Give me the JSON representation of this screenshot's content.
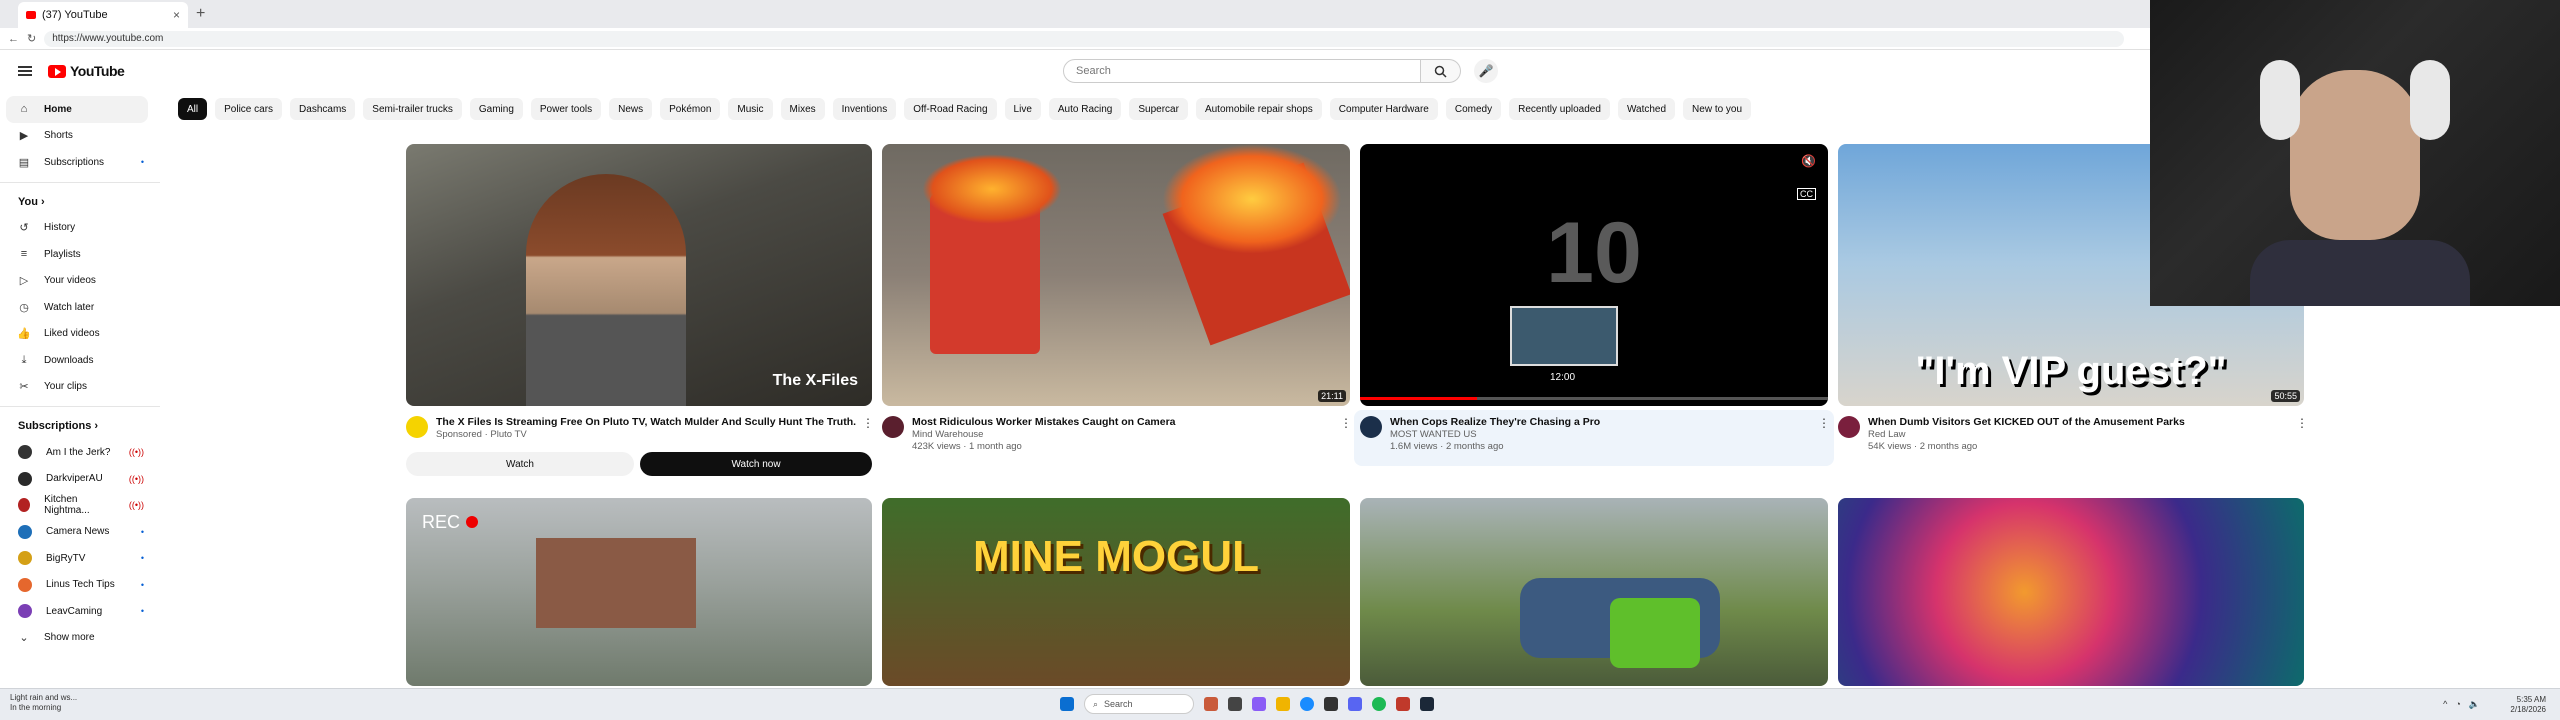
{
  "browser": {
    "tab_title": "(37) YouTube",
    "url": "https://www.youtube.com"
  },
  "header": {
    "logo_text": "YouTube",
    "search_placeholder": "Search"
  },
  "chips": [
    "All",
    "Police cars",
    "Dashcams",
    "Semi-trailer trucks",
    "Gaming",
    "Power tools",
    "News",
    "Pokémon",
    "Music",
    "Mixes",
    "Inventions",
    "Off-Road Racing",
    "Live",
    "Auto Racing",
    "Supercar",
    "Automobile repair shops",
    "Computer Hardware",
    "Comedy",
    "Recently uploaded",
    "Watched",
    "New to you"
  ],
  "sidebar": {
    "main": [
      {
        "label": "Home",
        "icon": "home-icon"
      },
      {
        "label": "Shorts",
        "icon": "shorts-icon"
      },
      {
        "label": "Subscriptions",
        "icon": "subscriptions-icon"
      }
    ],
    "you_heading": "You",
    "you": [
      {
        "label": "History",
        "icon": "history-icon"
      },
      {
        "label": "Playlists",
        "icon": "playlists-icon"
      },
      {
        "label": "Your videos",
        "icon": "your-videos-icon"
      },
      {
        "label": "Watch later",
        "icon": "watch-later-icon"
      },
      {
        "label": "Liked videos",
        "icon": "liked-icon"
      },
      {
        "label": "Downloads",
        "icon": "downloads-icon"
      },
      {
        "label": "Your clips",
        "icon": "clips-icon"
      }
    ],
    "subs_heading": "Subscriptions",
    "subs": [
      {
        "label": "Am I the Jerk?",
        "color": "#333333"
      },
      {
        "label": "DarkviperAU",
        "color": "#2a2a2a"
      },
      {
        "label": "Kitchen Nightma...",
        "color": "#b22222"
      },
      {
        "label": "Camera News",
        "color": "#1e6fb8"
      },
      {
        "label": "BigRyTV",
        "color": "#d4a017"
      },
      {
        "label": "Linus Tech Tips",
        "color": "#e5672d"
      },
      {
        "label": "LeavCaming",
        "color": "#7b3fb5"
      }
    ],
    "show_more": "Show more"
  },
  "videos": [
    {
      "title": "The X Files Is Streaming Free On Pluto TV, Watch Mulder And Scully Hunt The Truth.",
      "channel": "Sponsored · Pluto TV",
      "stats": "",
      "duration": "",
      "overlay": "The X-Files"
    },
    {
      "title": "Most Ridiculous Worker Mistakes Caught on Camera",
      "channel": "Mind Warehouse",
      "stats": "423K views · 1 month ago",
      "duration": "21:11",
      "overlay": ""
    },
    {
      "title": "When Cops Realize They're Chasing a Pro",
      "channel": "MOST WANTED US",
      "stats": "1.6M views · 2 months ago",
      "duration": "12:00",
      "overlay": "10"
    },
    {
      "title": "When Dumb Visitors Get KICKED OUT of the Amusement Parks",
      "channel": "Red Law",
      "stats": "54K views · 2 months ago",
      "duration": "50:55",
      "overlay": "\"I'm VIP guest?\""
    }
  ],
  "ad_buttons": {
    "watch": "Watch",
    "watch_now": "Watch now"
  },
  "row2": [
    {
      "overlay": "REC"
    },
    {
      "overlay": "MINE MOGUL"
    },
    {
      "overlay": ""
    },
    {
      "overlay": ""
    }
  ],
  "taskbar": {
    "weather_line1": "Light rain and ws...",
    "weather_line2": "In the morning",
    "search": "Search",
    "time": "5:35 AM",
    "date": "2/18/2026"
  },
  "colors": {
    "accent": "#ff0000",
    "active_chip": "#0f0f0f"
  }
}
